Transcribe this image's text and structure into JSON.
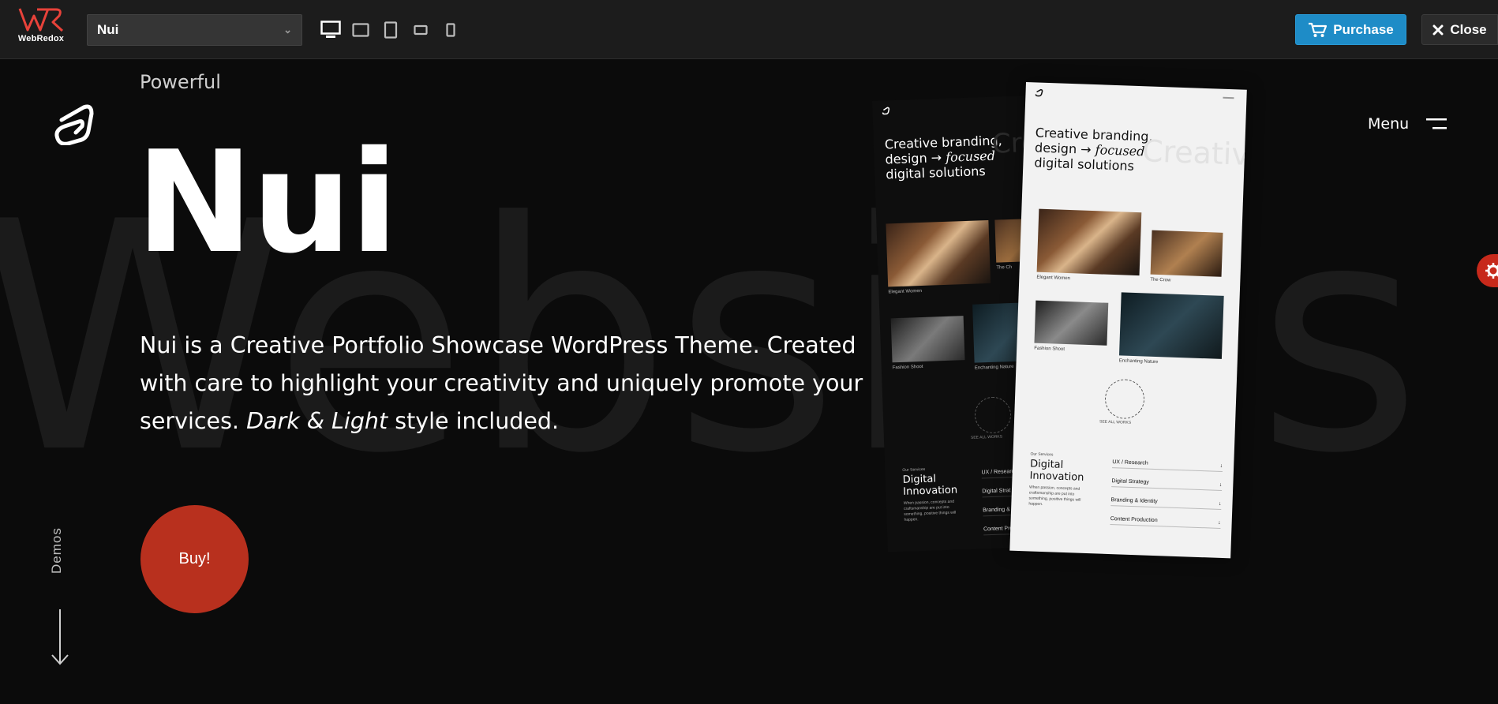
{
  "topbar": {
    "logo_text": "WebRedox",
    "demo_select": "Nui",
    "devices": [
      "desktop-icon",
      "tablet-landscape-icon",
      "tablet-portrait-icon",
      "mobile-landscape-icon",
      "mobile-portrait-icon"
    ],
    "purchase_label": "Purchase",
    "close_label": "Close"
  },
  "hero": {
    "watermark": "Websites",
    "eyebrow": "Powerful",
    "title": "Nui",
    "description_main": "Nui is a Creative Portfolio Showcase WordPress Theme. Created with care to highlight your creativity and uniquely promote your services.",
    "description_italic": "Dark & Light",
    "description_tail": "style included.",
    "buy_label": "Buy!",
    "demos_label": "Demos",
    "menu_label": "Menu"
  },
  "preview": {
    "headline_1": "Creative branding,",
    "headline_2a": "design → ",
    "headline_2b": "focused",
    "headline_3": "digital solutions",
    "faint_word": "Creative",
    "dark_captions": [
      "Elegant Women",
      "The Ch",
      "Fashion Shoot",
      "Enchanting Nature"
    ],
    "light_captions": [
      "Elegant Women",
      "The Crow",
      "Fashion Shoot",
      "Enchanting Nature"
    ],
    "see_all_text": "SEE ALL WORKS",
    "services_sub": "Our Services",
    "services_title_1": "Digital",
    "services_title_2": "Innovation",
    "services_note": "When passion, concepts and craftsmanship are put into something, positive things will happen.",
    "services": [
      "UX / Research",
      "Digital Strategy",
      "Branding & Identity",
      "Content Production"
    ],
    "dark_services": [
      "UX / Researc",
      "Digital Strat",
      "Branding & I",
      "Content Pro"
    ],
    "arrow_glyph": "↓"
  },
  "colors": {
    "background": "#0b0b0b",
    "topbar": "#1c1c1c",
    "purchase": "#1e8cc7",
    "buy": "#b8301e",
    "gear": "#c7291b",
    "logo": "#e8423a"
  }
}
